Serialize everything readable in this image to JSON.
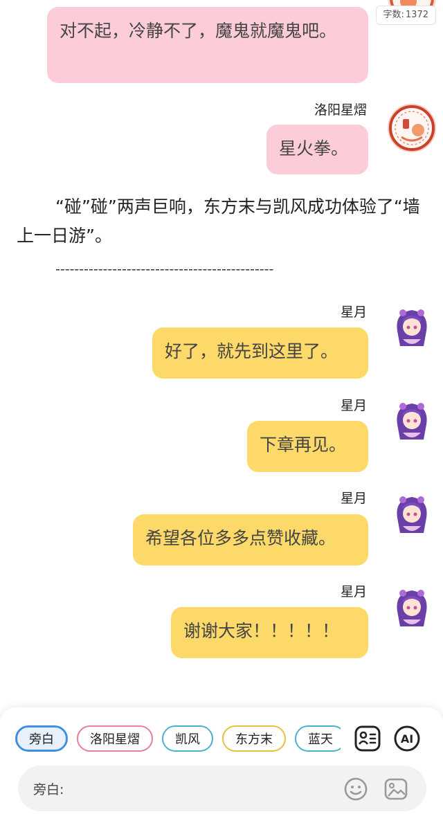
{
  "header": {
    "word_count_label": "字数:",
    "word_count_value": "1372"
  },
  "messages": [
    {
      "sender": "",
      "text": "对不起，冷静不了，魔鬼就魔鬼吧。",
      "color": "#fdccd9"
    },
    {
      "sender": "洛阳星熠",
      "text": "星火拳。",
      "color": "#fdccd9"
    },
    {
      "sender": "星月",
      "text": "好了，就先到这里了。",
      "color": "#fdd96a"
    },
    {
      "sender": "星月",
      "text": "下章再见。",
      "color": "#fdd96a"
    },
    {
      "sender": "星月",
      "text": "希望各位多多点赞收藏。",
      "color": "#fdd96a"
    },
    {
      "sender": "星月",
      "text": "谢谢大家！！！！！",
      "color": "#fdd96a"
    }
  ],
  "narration": {
    "text": "“碰”碰”两声巨响，东方末与凯风成功体验了“墙上一日游”。",
    "divider": "----------------------------------------------"
  },
  "bottom": {
    "chips": [
      {
        "label": "旁白",
        "color": "#3f8fe0",
        "selected": true
      },
      {
        "label": "洛阳星熠",
        "color": "#e57f9a"
      },
      {
        "label": "凯风",
        "color": "#49b1cf"
      },
      {
        "label": "东方末",
        "color": "#e8c13a"
      },
      {
        "label": "蓝天",
        "color": "#49b1cf"
      }
    ],
    "ai_label": "AI",
    "input_label": "旁白:",
    "icons": {
      "contacts": "contact-card-icon",
      "emoji": "emoji-icon",
      "image": "image-icon"
    }
  }
}
